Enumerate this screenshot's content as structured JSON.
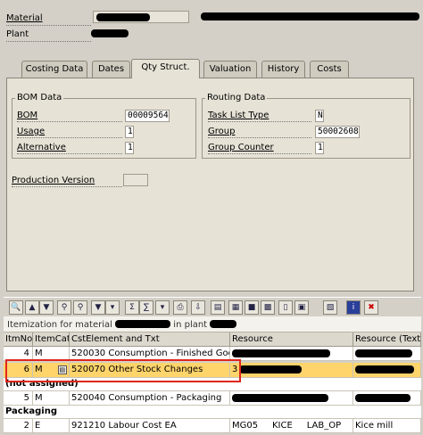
{
  "header": {
    "material_label": "Material",
    "plant_label": "Plant"
  },
  "tabs": [
    {
      "label": "Costing Data"
    },
    {
      "label": "Dates"
    },
    {
      "label": "Qty Struct."
    },
    {
      "label": "Valuation"
    },
    {
      "label": "History"
    },
    {
      "label": "Costs"
    }
  ],
  "bom_data": {
    "title": "BOM Data",
    "bom_label": "BOM",
    "bom_value": "00009564",
    "usage_label": "Usage",
    "usage_value": "1",
    "alternative_label": "Alternative",
    "alternative_value": "1"
  },
  "routing_data": {
    "title": "Routing Data",
    "task_list_type_label": "Task List Type",
    "task_list_type_value": "N",
    "group_label": "Group",
    "group_value": "50002608",
    "group_counter_label": "Group Counter",
    "group_counter_value": "1"
  },
  "production_version_label": "Production Version",
  "grid": {
    "title_prefix": "Itemization for material",
    "title_mid": "in plant",
    "headers": [
      "ItmNo",
      "ItemCat",
      "CstElement and Txt",
      "Resource",
      "Resource (Text)"
    ],
    "rows": [
      {
        "itmno": "4",
        "itemcat": "M",
        "cst": "520030  Consumption - Finished Goo",
        "res": "",
        "restext": ""
      },
      {
        "itmno": "6",
        "itemcat": "M",
        "cst": "520070  Other Stock Changes",
        "res": "3",
        "restext": ""
      },
      {
        "itmno": "5",
        "itemcat": "M",
        "cst": "520040  Consumption - Packaging",
        "res": "",
        "restext": ""
      },
      {
        "itmno": "2",
        "itemcat": "E",
        "cst": "921210  Labour Cost EA",
        "res": "MG05     KICE     LAB_OP",
        "restext": "Kice mill"
      }
    ],
    "group_not_assigned": "(not assigned)",
    "group_packaging": "Packaging"
  }
}
